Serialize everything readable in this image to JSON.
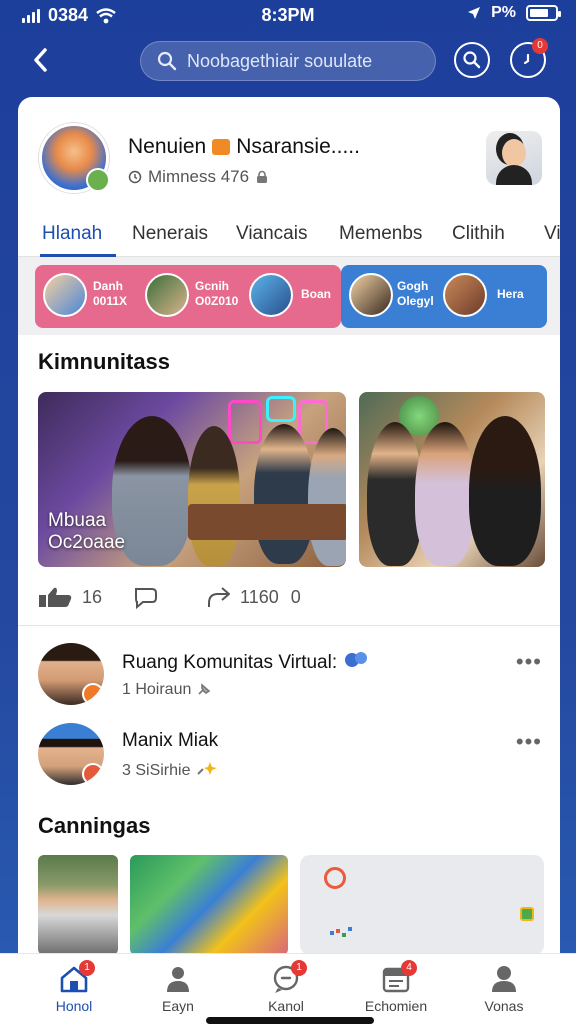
{
  "status_bar": {
    "carrier": "0384",
    "time": "8:3PM",
    "network": "P%"
  },
  "top_bar": {
    "search_placeholder": "Noobagethiair souulate",
    "notification_count": "0"
  },
  "group": {
    "name_part1": "Nenuien",
    "name_part2": "Nsaransie.....",
    "members": "Mimness 476"
  },
  "tabs": [
    {
      "label": "Hlanah"
    },
    {
      "label": "Nenerais"
    },
    {
      "label": "Viancais"
    },
    {
      "label": "Memenbs"
    },
    {
      "label": "Clithih"
    },
    {
      "label": "Vi"
    }
  ],
  "stories": {
    "chip1": {
      "line1": "Danh",
      "line2": "0011X"
    },
    "chip2": {
      "line1": "Gcnih",
      "line2": "O0Z010"
    },
    "chip3": {
      "line1": "Boan"
    },
    "chip4": {
      "line1": "Gogh",
      "line2": "Olegyl"
    },
    "chip5": {
      "line1": "Hera"
    }
  },
  "community_section": {
    "title": "Kimnunitass",
    "photo_caption_line1": "Mbuaa",
    "photo_caption_line2": "Oc2oaae",
    "likes": "16",
    "shares": "1160",
    "extra": "0"
  },
  "list": [
    {
      "title": "Ruang Komunitas Virtual:",
      "subtitle": "1 Hoiraun"
    },
    {
      "title": "Manix Miak",
      "subtitle": "3 SiSirhie"
    }
  ],
  "campaign_section": {
    "title": "Canningas"
  },
  "bottom_nav": [
    {
      "label": "Honol",
      "badge": "1"
    },
    {
      "label": "Eayn"
    },
    {
      "label": "Kanol",
      "badge": "1"
    },
    {
      "label": "Echomien",
      "badge": "4"
    },
    {
      "label": "Vonas"
    }
  ],
  "colors": {
    "accent": "#1d4fb0",
    "background": "#1d3f9c",
    "badge": "#e53935",
    "story_pink": "#e66a8e",
    "story_blue": "#3b7fd4"
  }
}
